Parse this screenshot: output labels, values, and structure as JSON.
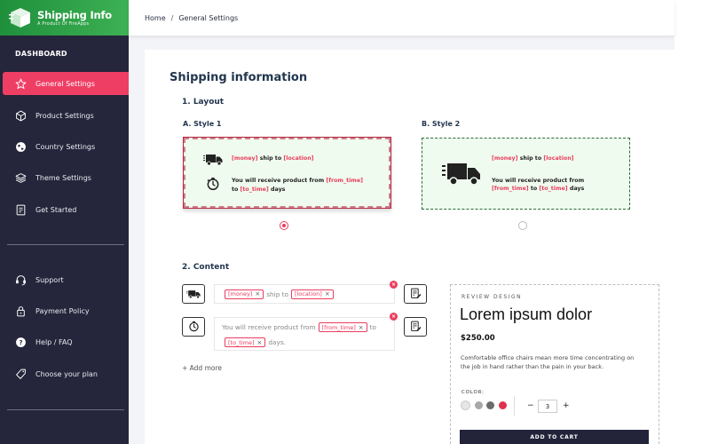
{
  "app": {
    "title": "Shipping Info",
    "subtitle": "A Product Of FireApps"
  },
  "sidebar": {
    "section_label": "DASHBOARD",
    "items": [
      {
        "label": "General Settings",
        "icon": "star-icon",
        "active": true
      },
      {
        "label": "Product Settings",
        "icon": "box-icon",
        "active": false
      },
      {
        "label": "Country Settings",
        "icon": "globe-icon",
        "active": false
      },
      {
        "label": "Theme Settings",
        "icon": "layers-icon",
        "active": false
      },
      {
        "label": "Get Started",
        "icon": "document-icon",
        "active": false
      }
    ],
    "bottom_items": [
      {
        "label": "Support",
        "icon": "headset-icon"
      },
      {
        "label": "Payment Policy",
        "icon": "lock-icon"
      },
      {
        "label": "Help / FAQ",
        "icon": "question-icon"
      },
      {
        "label": "Choose your plan",
        "icon": "tag-icon"
      }
    ]
  },
  "breadcrumb": {
    "home": "Home",
    "separator": "/",
    "current": "General Settings"
  },
  "main": {
    "title": "Shipping information",
    "layout_heading": "1. Layout",
    "style_a": {
      "label": "A. Style 1",
      "line1_tag1": "[money]",
      "line1_mid": "ship to",
      "line1_tag2": "[location]",
      "line2_pre": "You will receive product from",
      "line2_tag1": "[from_time]",
      "line2_to": "to",
      "line2_tag2": "[to_time]",
      "line2_post": "days",
      "selected": true
    },
    "style_b": {
      "label": "B. Style 2",
      "line1_tag1": "[money]",
      "line1_mid": "ship to",
      "line1_tag2": "[location]",
      "line2_pre": "You will receive product from",
      "line2_tag1": "[from_time]",
      "line2_to": "to",
      "line2_tag2": "[to_time]",
      "line2_post": "days",
      "selected": false
    },
    "content_heading": "2. Content",
    "row1": {
      "chip1": "[money]",
      "text": "ship to",
      "chip2": "[location]"
    },
    "row2": {
      "pre": "You will receive product from",
      "chip1": "[from_time]",
      "to": "to",
      "chip2": "[to_time]",
      "post": "days."
    },
    "chip_remove": "×",
    "add_more": "+ Add more"
  },
  "review": {
    "label": "REVIEW DESIGN",
    "title": "Lorem ipsum dolor",
    "price": "$250.00",
    "description": "Comfortable office chairs mean more time concentrating on the job in hand rather than the pain in your back.",
    "color_label": "COLOR:",
    "swatches": [
      "#e6e6e6",
      "#a8a8a8",
      "#6b6b6b",
      "#e0304f"
    ],
    "qty_minus": "−",
    "qty": "3",
    "qty_plus": "+",
    "cta": "ADD TO CART"
  },
  "colors": {
    "sidebar_bg": "#25253b",
    "accent": "#ef3e64",
    "brand_green": "#2fa24a",
    "preview_bg": "#effbee"
  }
}
